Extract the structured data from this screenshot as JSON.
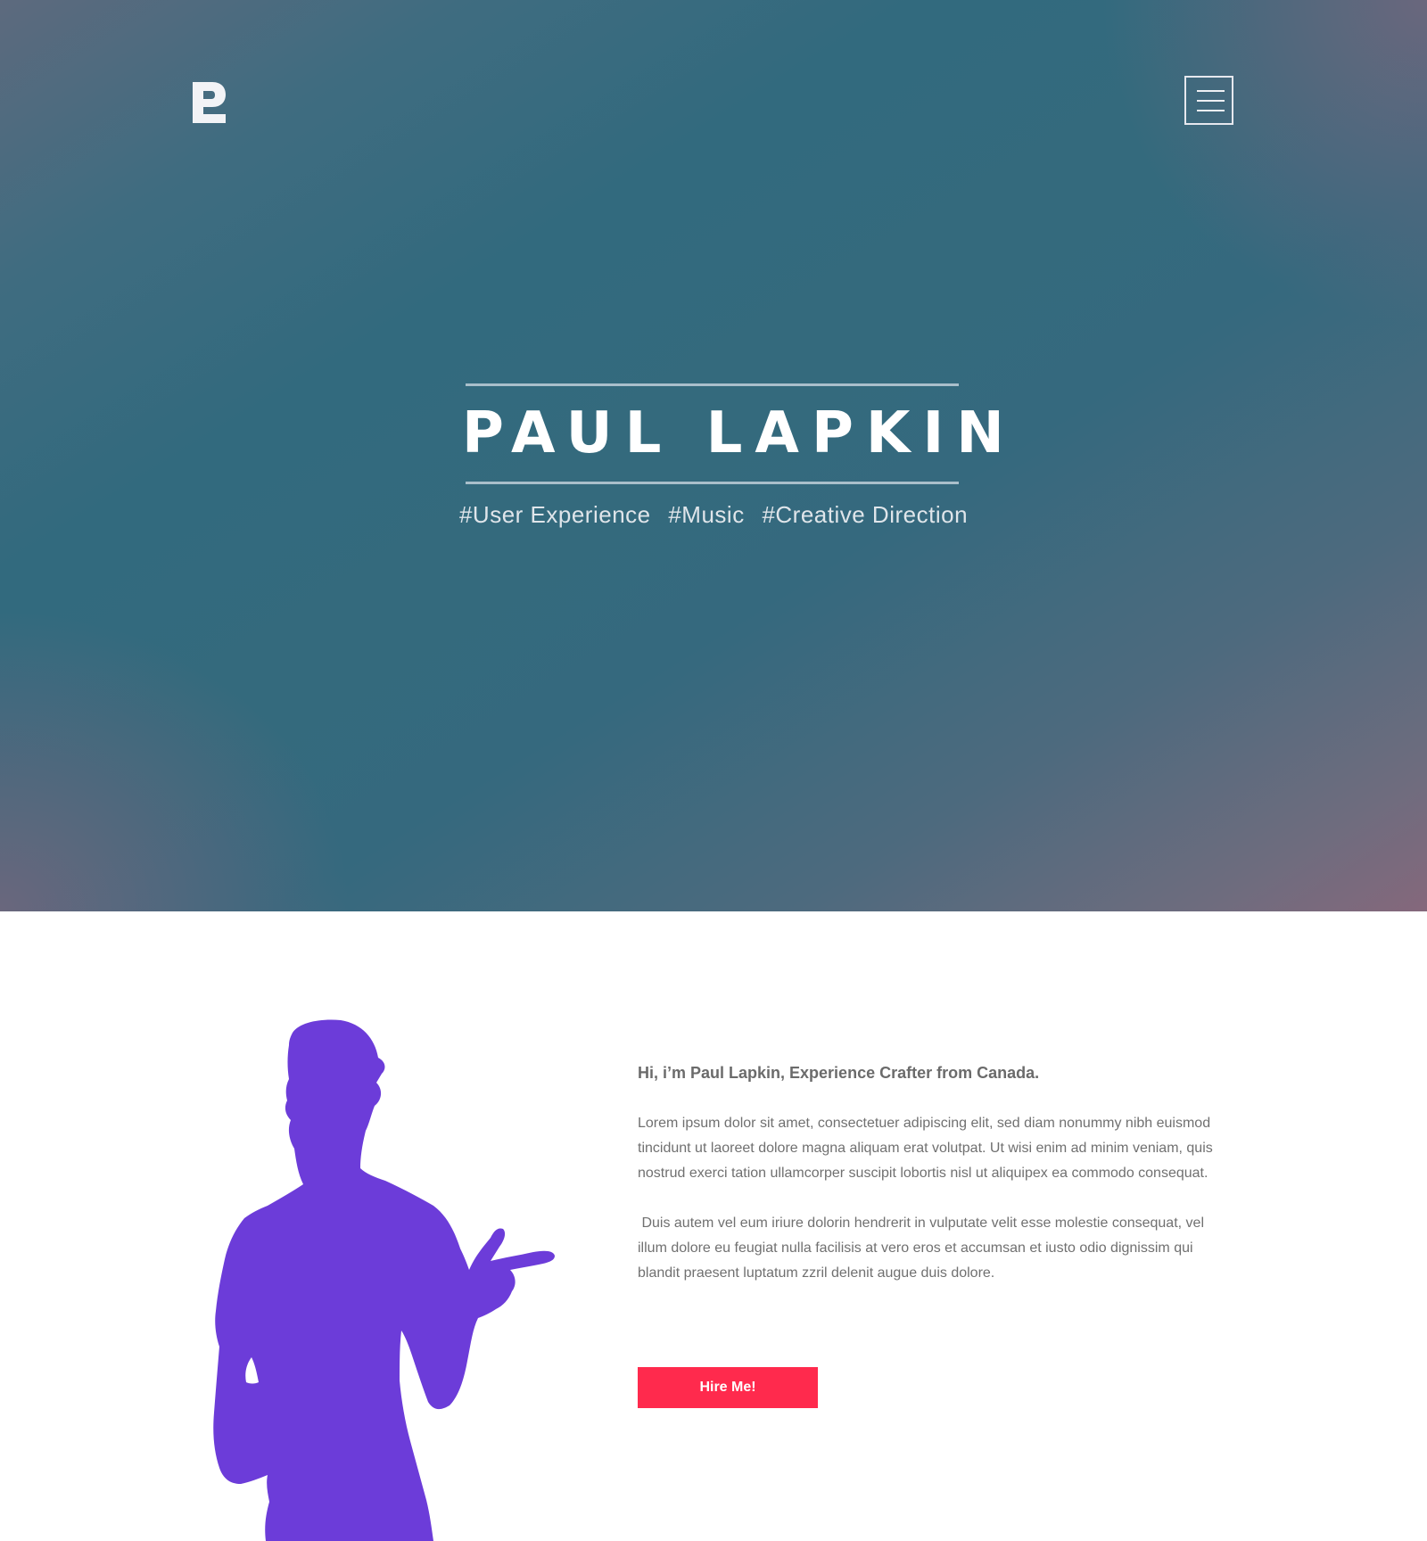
{
  "header": {
    "logo_icon": "p-monogram-icon",
    "menu_icon": "hamburger-menu-icon"
  },
  "hero": {
    "name": "PAUL LAPKIN",
    "tags": [
      "#User Experience",
      "#Music",
      "#Creative Direction"
    ]
  },
  "about": {
    "heading": "Hi, i’m Paul Lapkin, Experience Crafter from Canada.",
    "paragraphs": [
      "Lorem ipsum dolor sit amet, consectetuer adipiscing elit, sed diam nonummy nibh euismod tincidunt ut laoreet dolore magna aliquam erat volutpat. Ut wisi enim ad minim veniam, quis nostrud exerci tation ullamcorper suscipit lobortis nisl ut aliquipex ea commodo consequat.",
      " Duis autem vel eum iriure dolorin hendrerit in vulputate velit esse molestie consequat, vel illum dolore eu feugiat nulla facilisis at vero eros et accumsan et iusto odio dignissim qui blandit praesent luptatum zzril delenit augue duis dolore."
    ],
    "hire_label": "Hire Me!",
    "silhouette": "person-pointing-silhouette"
  },
  "colors": {
    "hero_teal": "#326a7e",
    "hero_mauve": "#85687c",
    "silhouette": "#6c3cd9",
    "button": "#ff2a4d",
    "text": "#707070"
  }
}
